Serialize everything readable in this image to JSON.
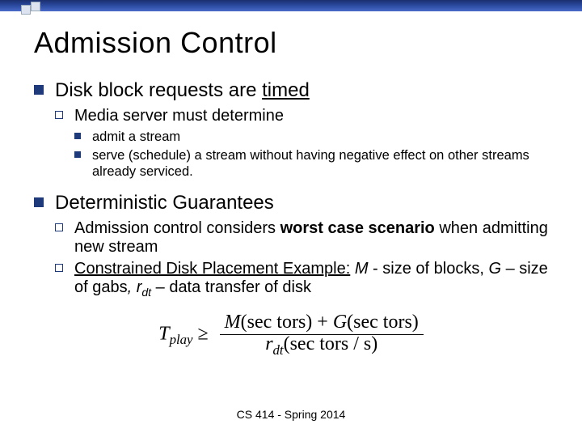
{
  "title": "Admission Control",
  "s1": {
    "heading": "Disk block requests are ",
    "heading_u": "timed",
    "sub1": "Media server must determine",
    "b1": " admit a stream",
    "b2": " serve (schedule) a stream without having negative effect on other streams already serviced."
  },
  "s2": {
    "heading": "Deterministic Guarantees",
    "p1a": "Admission control considers ",
    "p1b": "worst case scenario",
    "p1c": " when admitting new stream",
    "p2a": "Constrained Disk Placement Example:",
    "p2b": "  M ",
    "p2c": "- size of blocks, ",
    "p2d": "G ",
    "p2e": "– size of gabs",
    "p2f": ", r",
    "p2g": "dt",
    "p2h": " – data transfer of disk"
  },
  "formula": {
    "lhs": "T",
    "lhs_sub": "play",
    "ge": " ≥ ",
    "num1": "M",
    "num2": "(sec tors) + ",
    "num3": "G",
    "num4": "(sec tors)",
    "den1": "r",
    "den1_sub": "dt",
    "den2": "(sec tors / s)"
  },
  "footer": "CS 414 - Spring 2014"
}
